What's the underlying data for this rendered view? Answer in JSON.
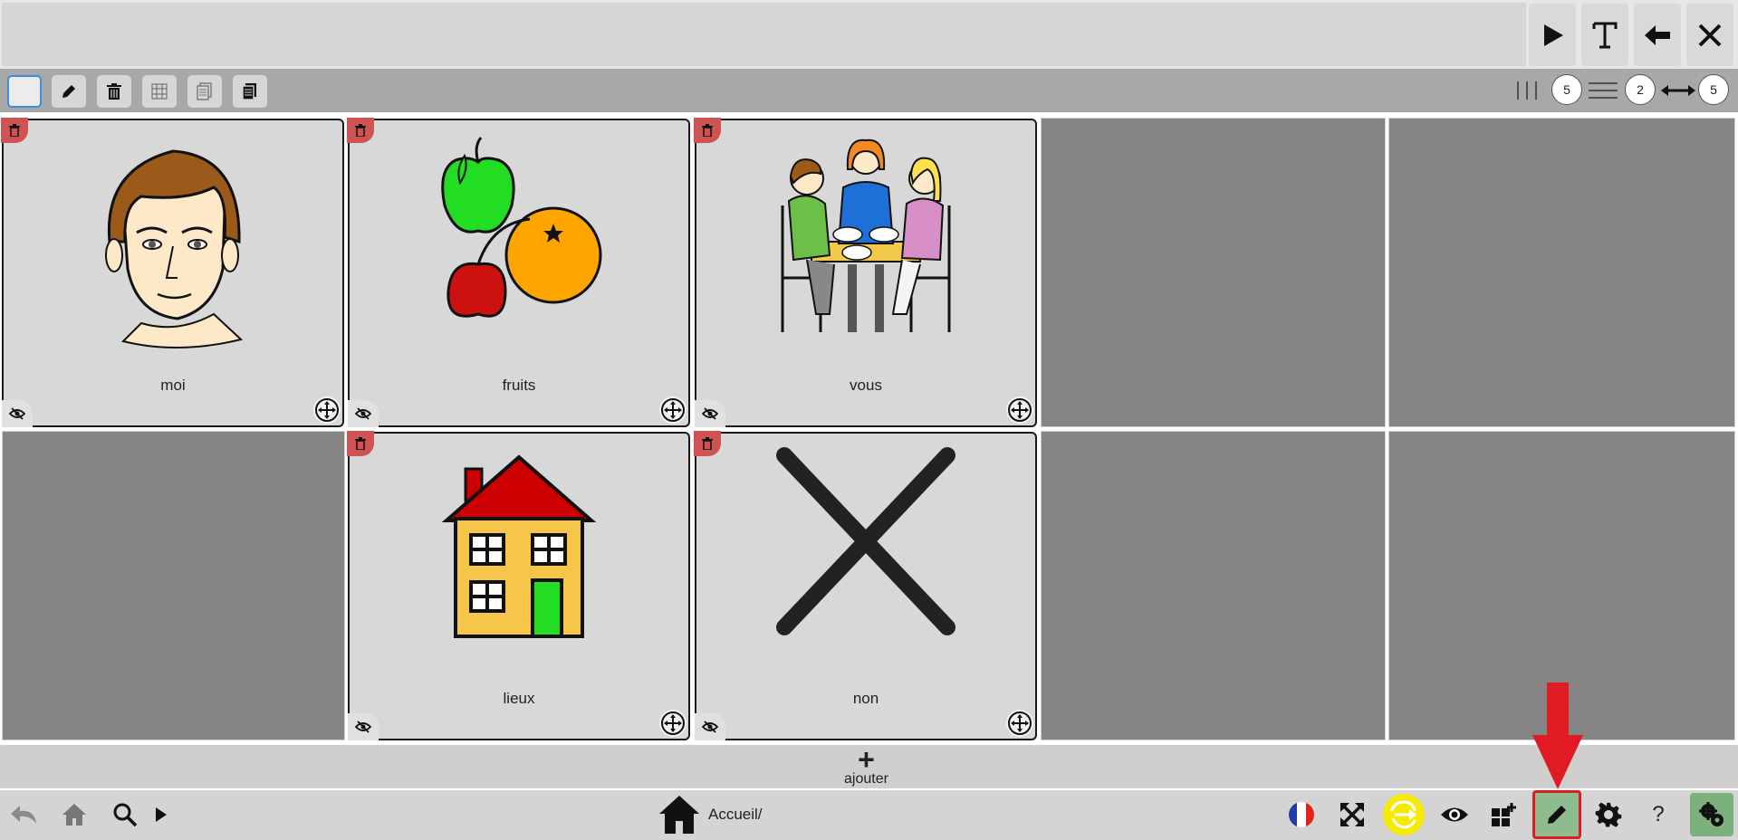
{
  "toolbar": {
    "rows_value": "5",
    "cols_value": "2",
    "width_value": "5"
  },
  "grid": {
    "cards": [
      {
        "label": "moi"
      },
      {
        "label": "fruits"
      },
      {
        "label": "vous"
      },
      {
        "label": "lieux"
      },
      {
        "label": "non"
      }
    ]
  },
  "addbar": {
    "label": "ajouter"
  },
  "bottom": {
    "breadcrumb": "Accueil/",
    "language": "fr",
    "active_tool": "edit",
    "highlight_color": "#e01b24"
  },
  "colors": {
    "trash_badge": "#cf5353",
    "edit_active": "#8fbc8f",
    "settings_active": "#7cb07c",
    "highlight_yellow": "#f5ea00"
  }
}
